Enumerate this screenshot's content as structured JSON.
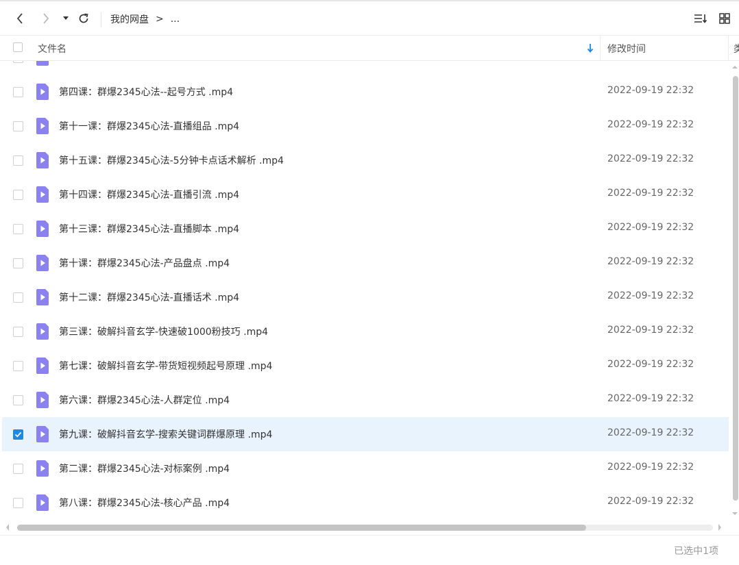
{
  "toolbar": {
    "breadcrumb_root": "我的网盘",
    "breadcrumb_sep": ">",
    "breadcrumb_more": "..."
  },
  "header": {
    "name_col": "文件名",
    "modified_col": "修改时间",
    "type_col": "类"
  },
  "files": [
    {
      "name": "第四课：群爆2345心法--起号方式 .mp4",
      "modified": "2022-09-19 22:32",
      "checked": false
    },
    {
      "name": "第十一课：群爆2345心法-直播组品 .mp4",
      "modified": "2022-09-19 22:32",
      "checked": false
    },
    {
      "name": "第十五课：群爆2345心法-5分钟卡点话术解析 .mp4",
      "modified": "2022-09-19 22:32",
      "checked": false
    },
    {
      "name": "第十四课：群爆2345心法-直播引流 .mp4",
      "modified": "2022-09-19 22:32",
      "checked": false
    },
    {
      "name": "第十三课：群爆2345心法-直播脚本 .mp4",
      "modified": "2022-09-19 22:32",
      "checked": false
    },
    {
      "name": "第十课：群爆2345心法-产品盘点 .mp4",
      "modified": "2022-09-19 22:32",
      "checked": false
    },
    {
      "name": "第十二课：群爆2345心法-直播话术 .mp4",
      "modified": "2022-09-19 22:32",
      "checked": false
    },
    {
      "name": "第三课：破解抖音玄学-快速破1000粉技巧 .mp4",
      "modified": "2022-09-19 22:32",
      "checked": false
    },
    {
      "name": "第七课：破解抖音玄学-带货短视频起号原理 .mp4",
      "modified": "2022-09-19 22:32",
      "checked": false
    },
    {
      "name": "第六课：群爆2345心法-人群定位 .mp4",
      "modified": "2022-09-19 22:32",
      "checked": false
    },
    {
      "name": "第九课：破解抖音玄学-搜索关键词群爆原理 .mp4",
      "modified": "2022-09-19 22:32",
      "checked": true
    },
    {
      "name": "第二课：群爆2345心法-对标案例 .mp4",
      "modified": "2022-09-19 22:32",
      "checked": false
    },
    {
      "name": "第八课：群爆2345心法-核心产品 .mp4",
      "modified": "2022-09-19 22:32",
      "checked": false
    }
  ],
  "footer": {
    "selection_status": "已选中1项"
  },
  "icons": {
    "back": "chevron-left-icon",
    "forward": "chevron-right-icon",
    "history": "caret-down-icon",
    "refresh": "refresh-icon",
    "sort": "sort-list-icon",
    "grid": "grid-view-icon",
    "file": "video-file-icon"
  },
  "colors": {
    "accent": "#1e88e5",
    "file_icon": "#8b82f0",
    "selected_row": "#e8f3fd"
  }
}
